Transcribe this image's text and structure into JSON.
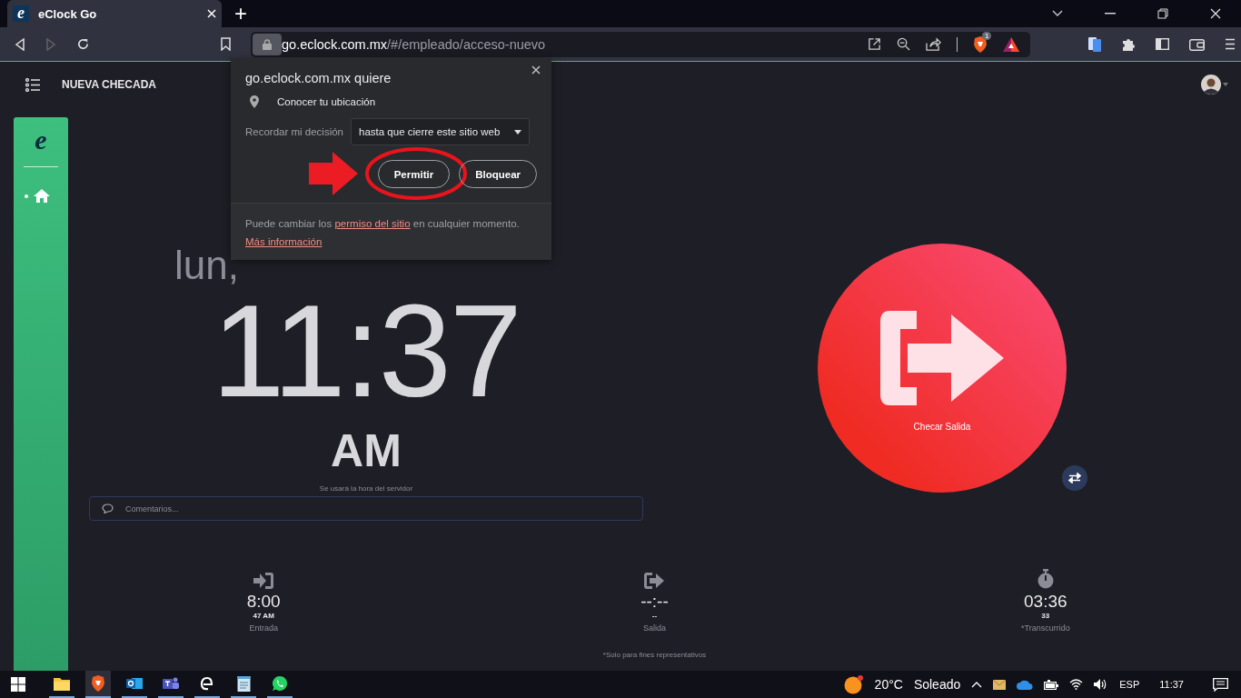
{
  "browser": {
    "tab": {
      "title": "eClock Go",
      "favicon": "e",
      "selected": true
    },
    "new_tab": "+",
    "address": {
      "host": "go.eclock.com.mx",
      "path": "/#/empleado/acceso-nuevo"
    },
    "shields_badge": "1"
  },
  "header": {
    "title": "NUEVA CHECADA"
  },
  "sidebar": {
    "logo": "e",
    "items": [
      {
        "kind": "home",
        "selected": true
      }
    ]
  },
  "clock": {
    "date": "lun,",
    "time": "11:37",
    "period": "AM",
    "note": "Se usará la hora del servidor"
  },
  "comment": {
    "placeholder": "Comentarios..."
  },
  "action": {
    "label": "Checar Salida"
  },
  "stats": [
    {
      "kind": "entrada",
      "value": "8:00",
      "sub": "47 AM",
      "label": "Entrada"
    },
    {
      "kind": "salida",
      "value": "--:--",
      "sub": "--",
      "label": "Salida"
    },
    {
      "kind": "elapsed",
      "value": "03:36",
      "sub": "33",
      "label": "*Transcurrido"
    }
  ],
  "footnote": "*Solo para fines representativos",
  "popup": {
    "site": "go.eclock.com.mx quiere",
    "permission": "Conocer tu ubicación",
    "remember_label": "Recordar mi decisión",
    "remember_value": "hasta que cierre este sitio web",
    "buttons": [
      {
        "label": "Permitir",
        "highlighted": true
      },
      {
        "label": "Bloquear",
        "highlighted": false
      }
    ],
    "footer_before": "Puede cambiar los",
    "footer_link": "permiso del sitio",
    "footer_after": "en cualquier momento.",
    "more_link": "Más información"
  },
  "taskbar": {
    "apps": [
      {
        "kind": "explorer",
        "active": false
      },
      {
        "kind": "brave",
        "active": true
      },
      {
        "kind": "outlook",
        "active": false
      },
      {
        "kind": "teams",
        "active": false
      },
      {
        "kind": "eclock",
        "active": false
      },
      {
        "kind": "notepad",
        "active": false
      },
      {
        "kind": "whatsapp",
        "active": false
      }
    ],
    "temperature": "20°C",
    "weather": "Soleado",
    "language": "ESP",
    "time": "11:37"
  }
}
